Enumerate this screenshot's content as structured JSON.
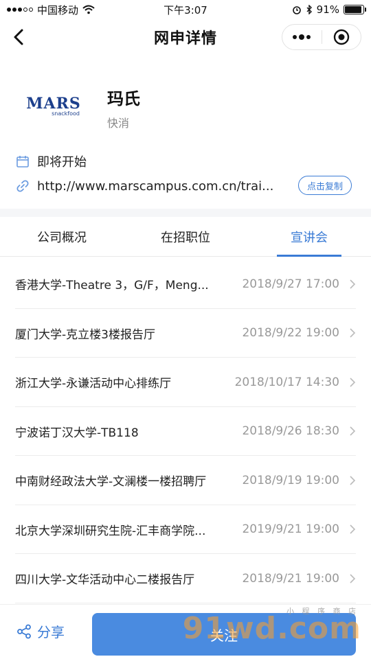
{
  "status_bar": {
    "carrier": "中国移动",
    "time": "下午3:07",
    "battery": "91%",
    "battery_level": 0.91
  },
  "nav": {
    "title": "网申详情"
  },
  "company": {
    "logo_text": "MARS",
    "logo_subtext": "snackfood",
    "name": "玛氏",
    "industry": "快消"
  },
  "info": {
    "status": "即将开始",
    "url": "http://www.marscampus.com.cn/trai...",
    "copy_label": "点击复制"
  },
  "tabs": [
    {
      "label": "公司概况",
      "active": false
    },
    {
      "label": "在招职位",
      "active": false
    },
    {
      "label": "宣讲会",
      "active": true
    }
  ],
  "seminars": [
    {
      "name": "香港大学-Theatre 3，G/F，Meng...",
      "time": "2018/9/27 17:00"
    },
    {
      "name": "厦门大学-克立楼3楼报告厅",
      "time": "2018/9/22 19:00"
    },
    {
      "name": "浙江大学-永谦活动中心排练厅",
      "time": "2018/10/17 14:30"
    },
    {
      "name": "宁波诺丁汉大学-TB118",
      "time": "2018/9/26 18:30"
    },
    {
      "name": "中南财经政法大学-文澜楼一楼招聘厅",
      "time": "2018/9/19 19:00"
    },
    {
      "name": "北京大学深圳研究生院-汇丰商学院...",
      "time": "2019/9/21 19:00"
    },
    {
      "name": "四川大学-文华活动中心二楼报告厅",
      "time": "2018/9/21 19:00"
    }
  ],
  "bottom": {
    "share_label": "分享",
    "follow_label": "关注"
  },
  "watermark": {
    "text": "91wd.com",
    "small": "小 程 序 商 店"
  },
  "colors": {
    "accent": "#3a7bd5",
    "follow_bg": "#4a8be0",
    "logo_blue": "#1c3f8c"
  }
}
